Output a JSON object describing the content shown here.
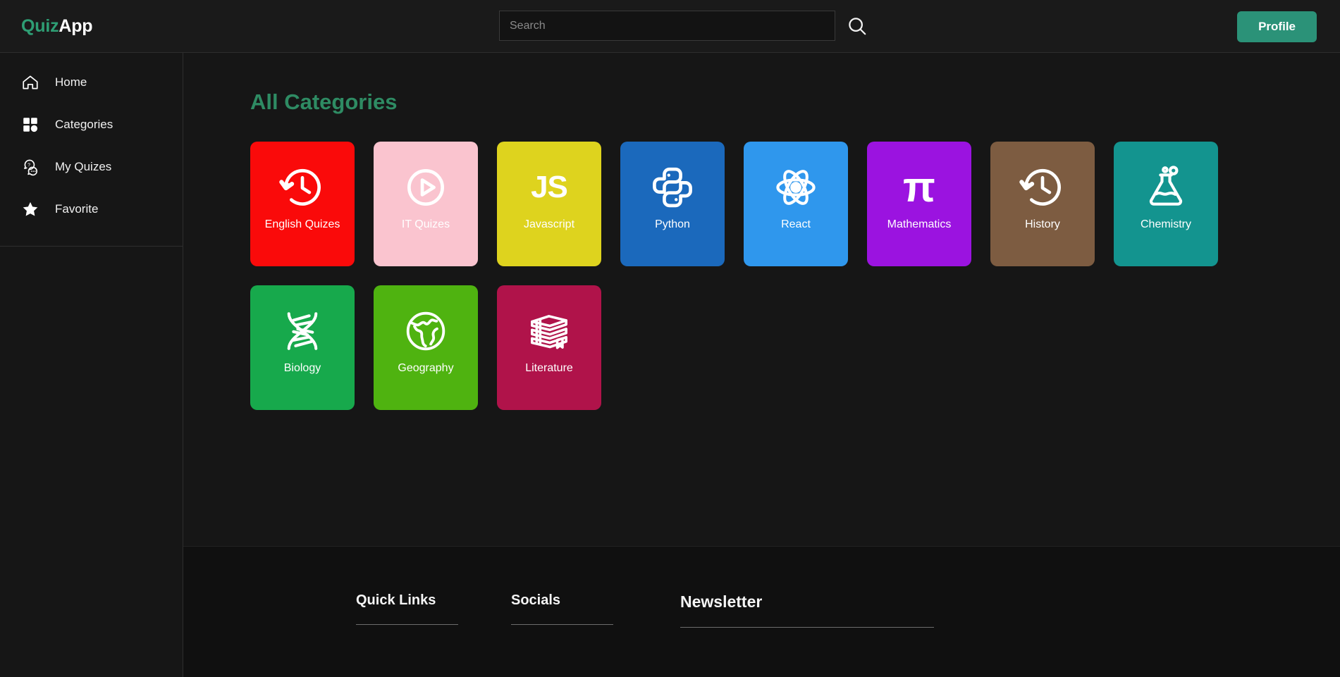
{
  "header": {
    "brand_first": "Quiz",
    "brand_second": "App",
    "search_placeholder": "Search",
    "search_value": "",
    "search_icon": "search-icon",
    "profile_label": "Profile",
    "accent_color": "#2b9278"
  },
  "sidebar": {
    "items": [
      {
        "label": "Home",
        "icon": "home-icon"
      },
      {
        "label": "Categories",
        "icon": "grid-icon"
      },
      {
        "label": "My Quizes",
        "icon": "chat-question-icon"
      },
      {
        "label": "Favorite",
        "icon": "star-icon"
      }
    ]
  },
  "main": {
    "title": "All Categories",
    "title_color": "#2e8b63",
    "categories": [
      {
        "label": "English Quizes",
        "color": "#fa0a0a",
        "icon": "history-clock-icon",
        "label_color": "#ffffff"
      },
      {
        "label": "IT Quizes",
        "color": "#fac4cf",
        "icon": "play-circle-icon",
        "label_color": "#ffffff"
      },
      {
        "label": "Javascript",
        "color": "#ded31e",
        "icon": "js-text-icon",
        "label_color": "#ffffff"
      },
      {
        "label": "Python",
        "color": "#1b69bc",
        "icon": "python-icon",
        "label_color": "#ffffff"
      },
      {
        "label": "React",
        "color": "#2f97ed",
        "icon": "atom-icon",
        "label_color": "#ffffff"
      },
      {
        "label": "Mathematics",
        "color": "#9b13e0",
        "icon": "pi-icon",
        "label_color": "#ffffff"
      },
      {
        "label": "History",
        "color": "#7d5c41",
        "icon": "history-clock-icon",
        "label_color": "#ffffff"
      },
      {
        "label": "Chemistry",
        "color": "#13948f",
        "icon": "flask-icon",
        "label_color": "#ffffff"
      },
      {
        "label": "Biology",
        "color": "#17a94c",
        "icon": "dna-icon",
        "label_color": "#ffffff"
      },
      {
        "label": "Geography",
        "color": "#4fb310",
        "icon": "globe-icon",
        "label_color": "#ffffff"
      },
      {
        "label": "Literature",
        "color": "#b0134a",
        "icon": "books-icon",
        "label_color": "#ffffff"
      }
    ]
  },
  "footer": {
    "quick_links_title": "Quick Links",
    "socials_title": "Socials",
    "newsletter_title": "Newsletter"
  }
}
